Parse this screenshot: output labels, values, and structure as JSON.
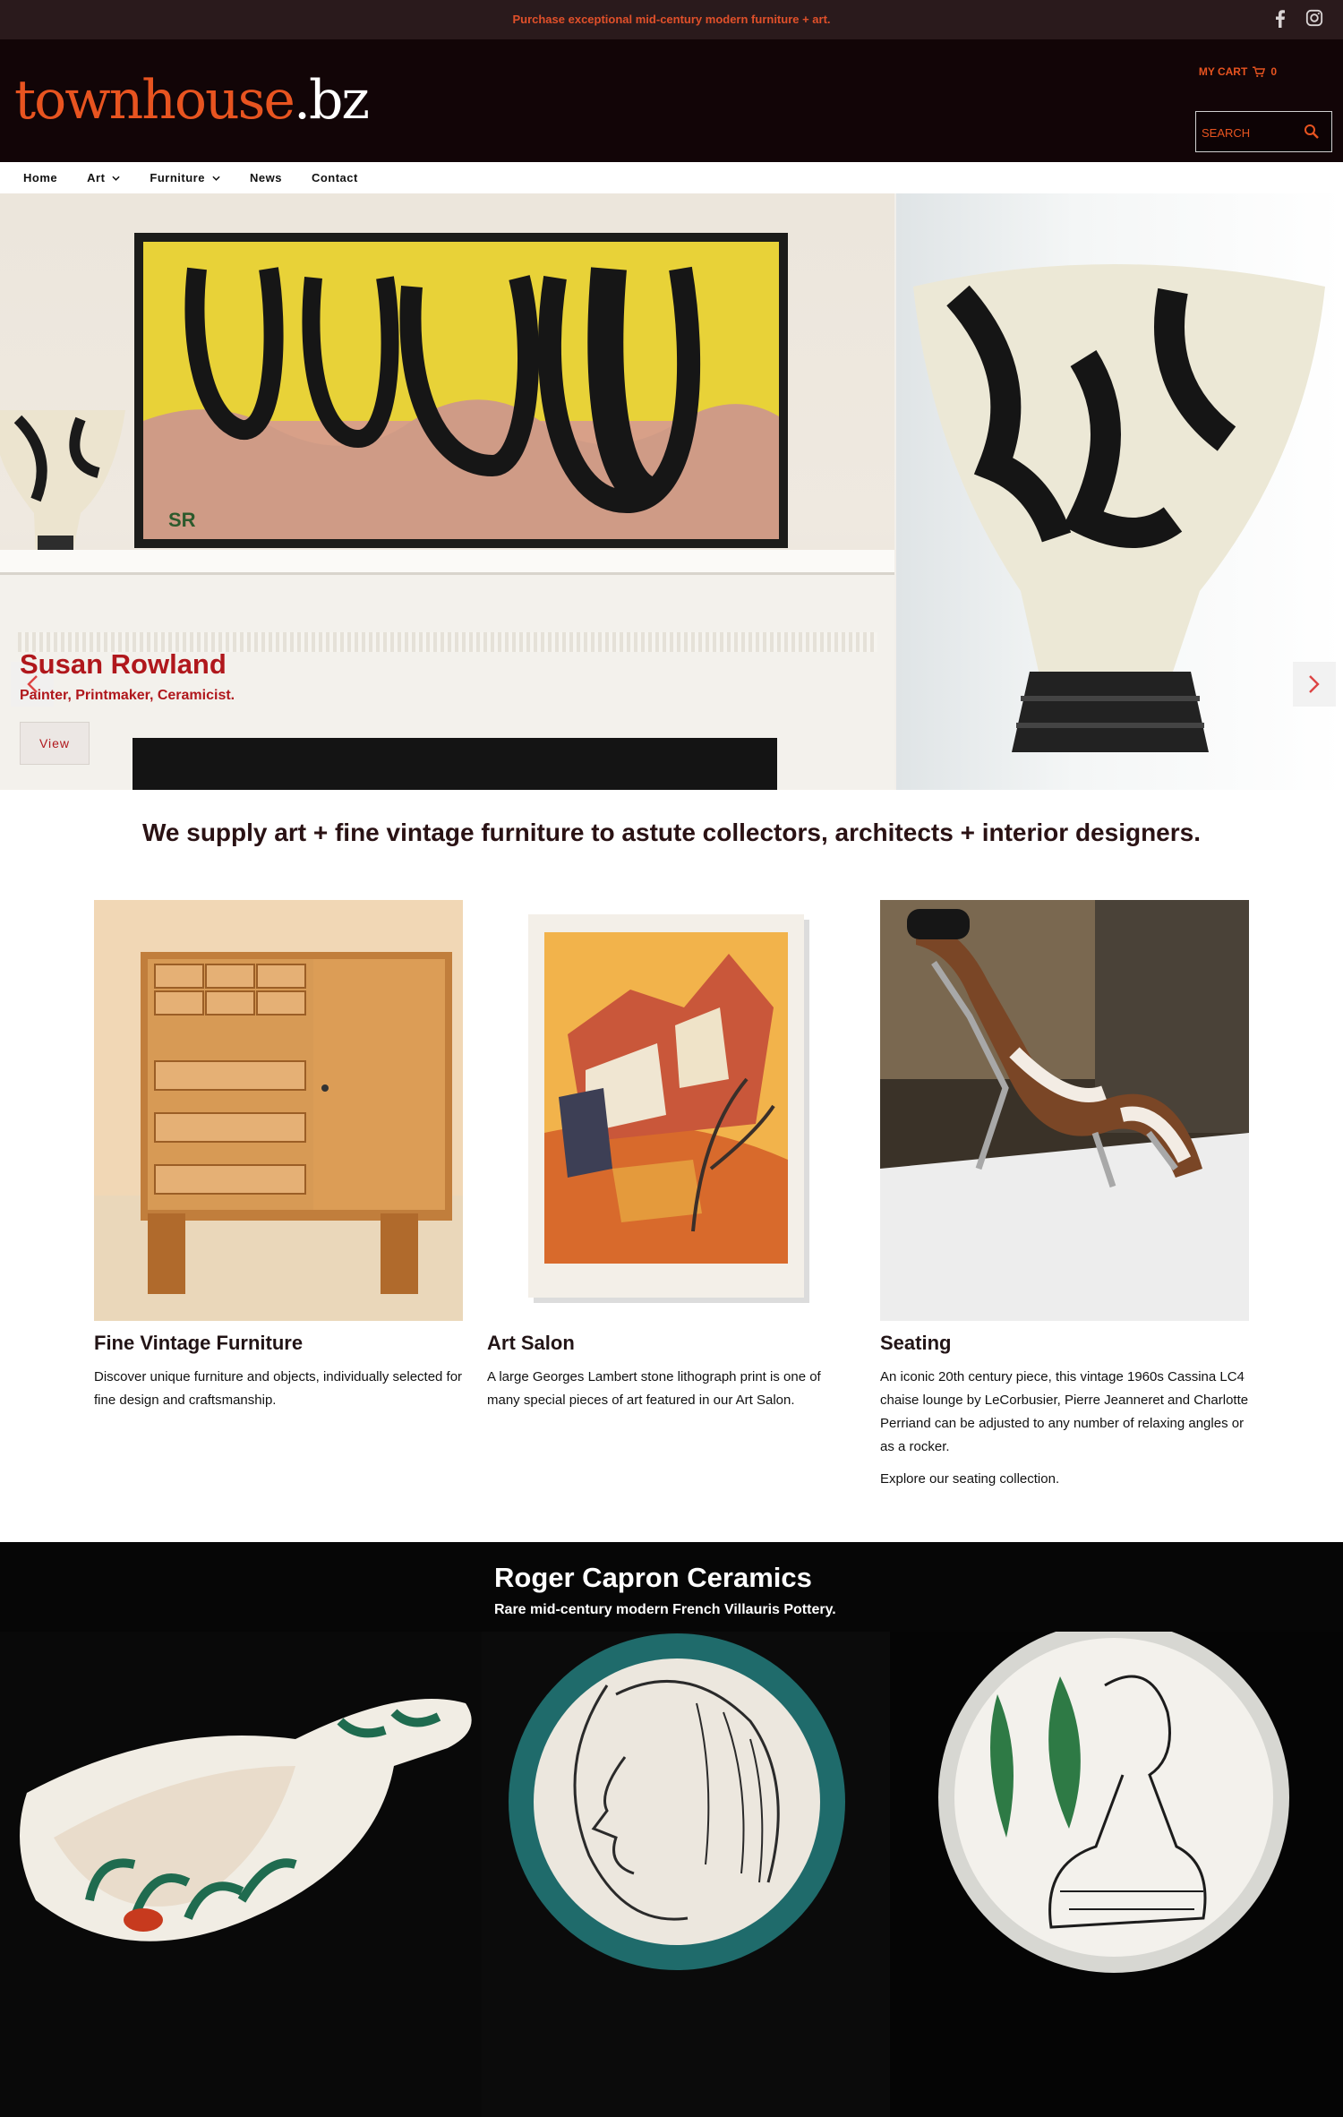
{
  "topbar": {
    "promo": "Purchase exceptional mid-century modern furniture + art.",
    "social": [
      "facebook-icon",
      "instagram-icon"
    ]
  },
  "header": {
    "logo_part1": "townhouse",
    "logo_part2": ".bz",
    "cart_label": "MY CART",
    "cart_count": "0",
    "search_placeholder": "SEARCH"
  },
  "nav": {
    "items": [
      {
        "label": "Home"
      },
      {
        "label": "Art"
      },
      {
        "label": "Furniture"
      },
      {
        "label": "News"
      },
      {
        "label": "Contact"
      }
    ]
  },
  "hero": {
    "artist_name": "Susan Rowland",
    "artist_role": "Painter, Printmaker, Ceramicist.",
    "view_label": "View",
    "signature": "SR"
  },
  "tagline": "We supply art + fine vintage furniture to astute collectors, architects + interior designers.",
  "features": [
    {
      "title": "Fine Vintage Furniture",
      "text": "Discover unique furniture and objects, individually selected for fine design and craftsmanship."
    },
    {
      "title": "Art Salon",
      "text": "A large Georges Lambert stone lithograph print is one of many special pieces of art featured in our Art Salon."
    },
    {
      "title": "Seating",
      "text": "An iconic 20th century piece, this vintage 1960s Cassina LC4 chaise lounge by LeCorbusier, Pierre Jeanneret and Charlotte Perriand can be adjusted to any number of relaxing angles or as a rocker.",
      "text2": "Explore our seating collection."
    }
  ],
  "ceramics": {
    "title": "Roger Capron Ceramics",
    "subtitle": "Rare mid-century modern French Villauris Pottery."
  },
  "colors": {
    "accent": "#e85420",
    "hero_text": "#b0171c",
    "header_bg": "#120507",
    "topbar_bg": "#2a1a1c"
  }
}
